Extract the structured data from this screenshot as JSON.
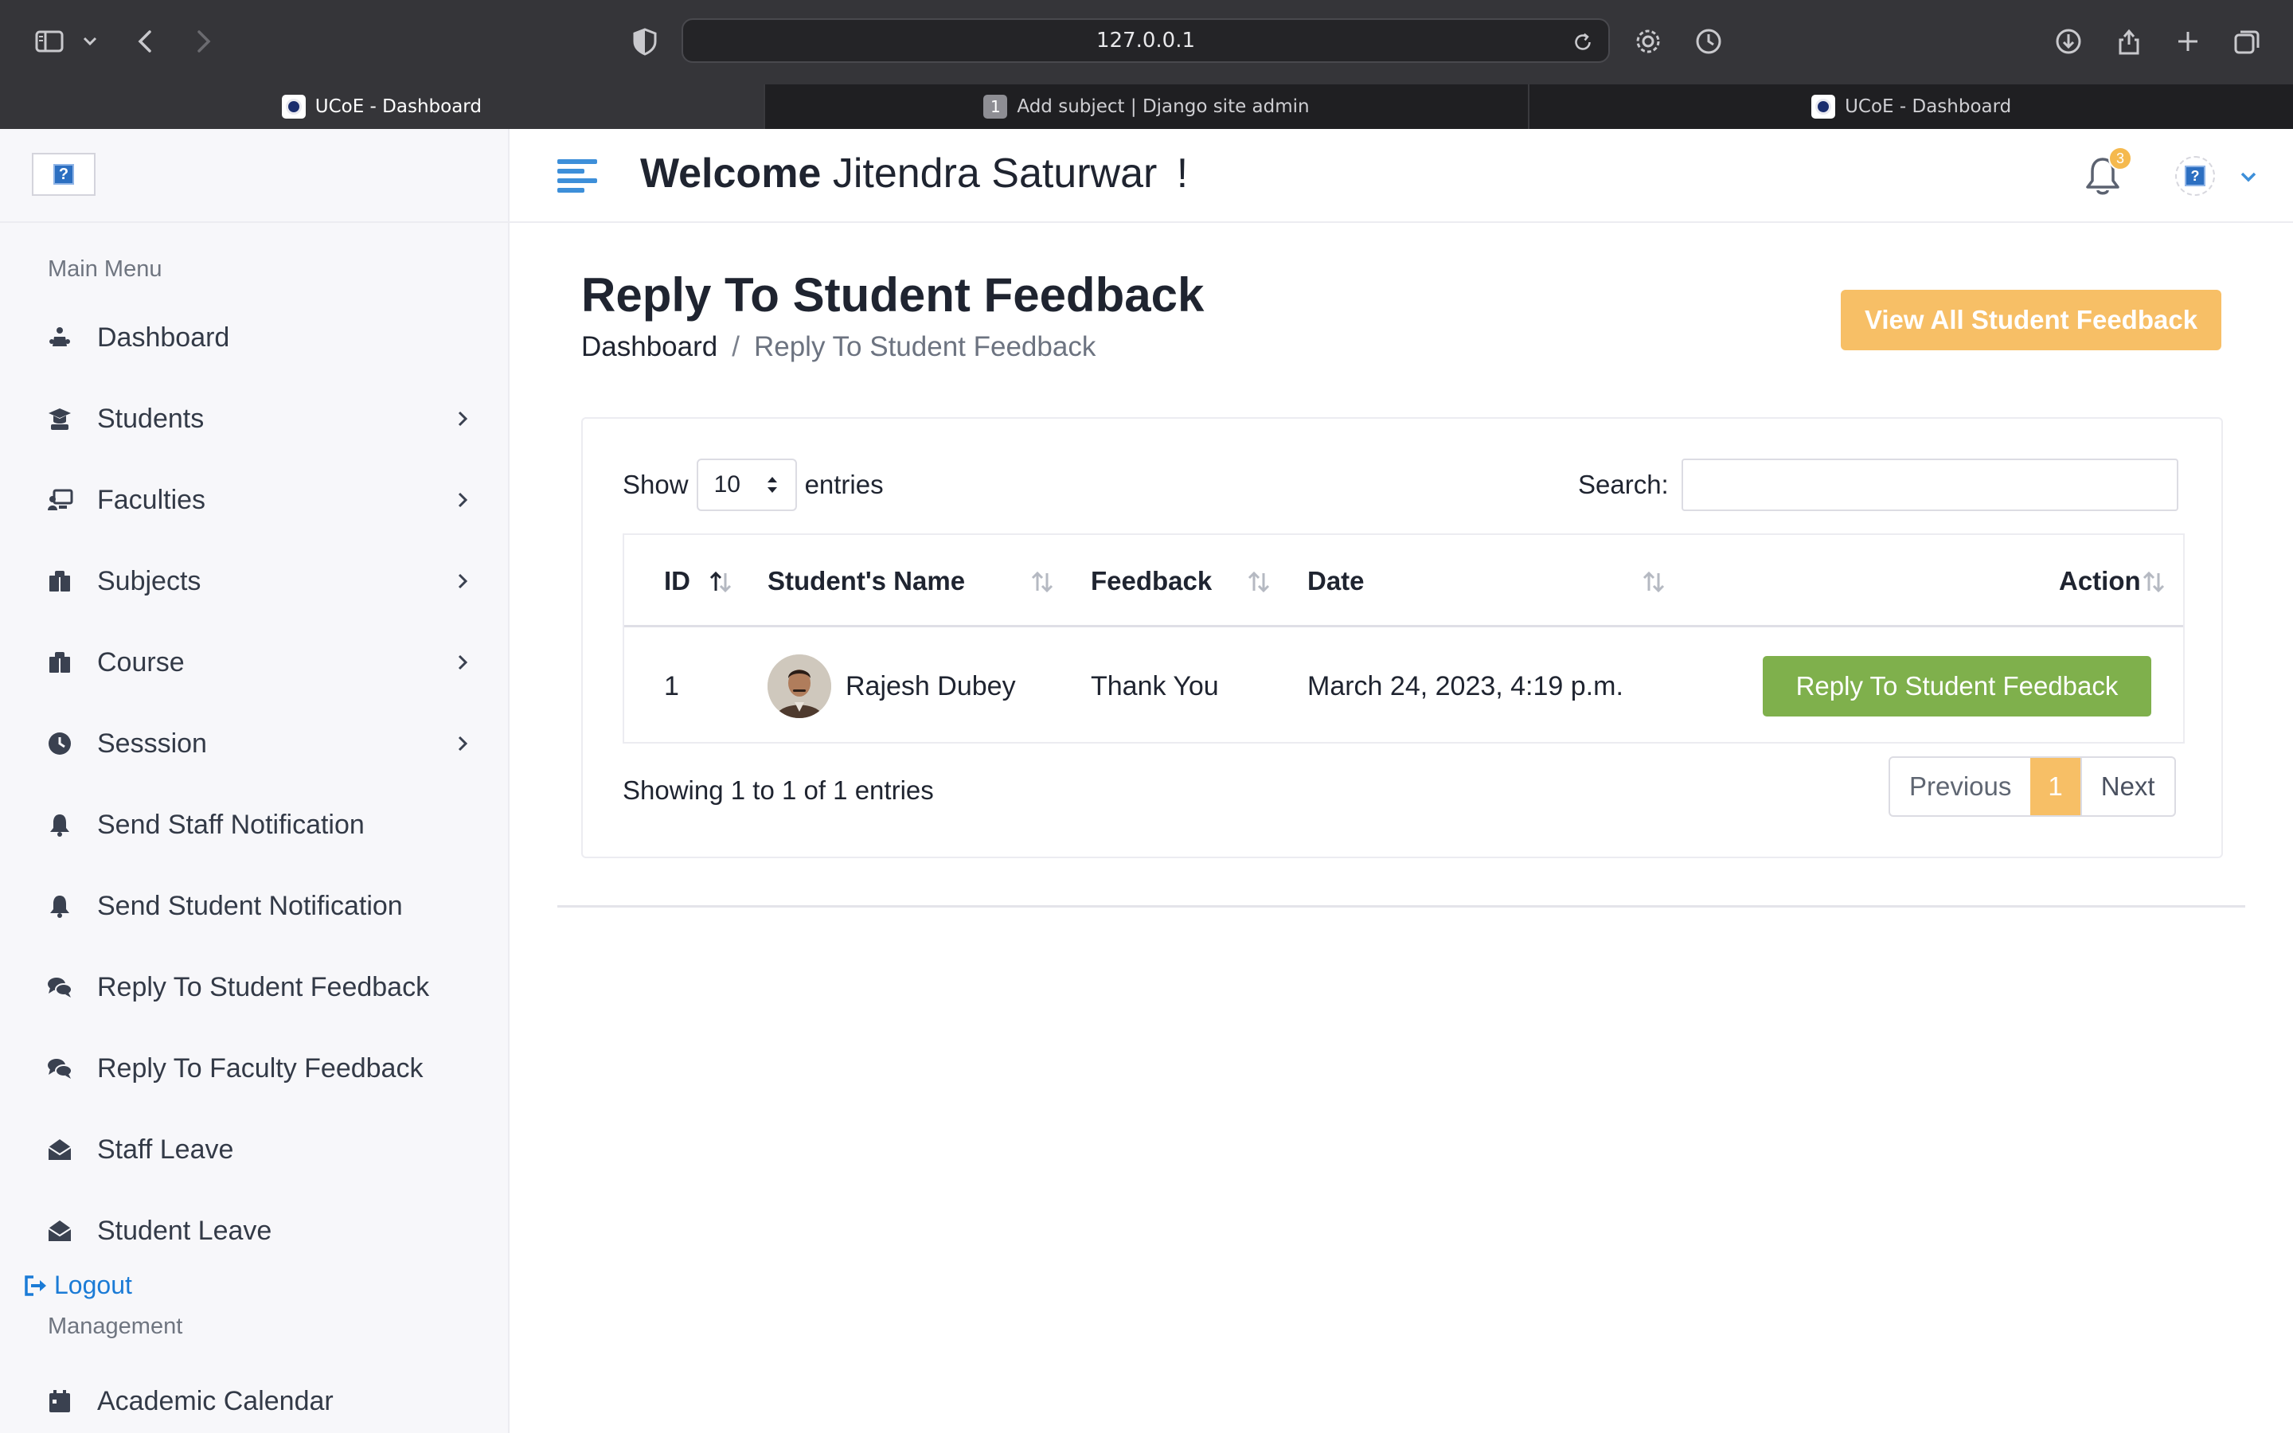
{
  "browser": {
    "url": "127.0.0.1",
    "tabs": [
      {
        "label": "UCoE - Dashboard",
        "active": true,
        "favicon": "ucoe-logo"
      },
      {
        "label": "Add subject | Django site admin",
        "active": false,
        "favicon_number": "1"
      },
      {
        "label": "UCoE - Dashboard",
        "active": false,
        "favicon": "ucoe-logo"
      }
    ]
  },
  "sidebar": {
    "logo_placeholder": "?",
    "main_menu_title": "Main Menu",
    "items": [
      {
        "label": "Dashboard",
        "icon": "dashboard-icon",
        "has_submenu": false
      },
      {
        "label": "Students",
        "icon": "student-icon",
        "has_submenu": true
      },
      {
        "label": "Faculties",
        "icon": "faculty-icon",
        "has_submenu": true
      },
      {
        "label": "Subjects",
        "icon": "book-icon",
        "has_submenu": true
      },
      {
        "label": "Course",
        "icon": "book-icon",
        "has_submenu": true
      },
      {
        "label": "Sesssion",
        "icon": "clock-icon",
        "has_submenu": true
      },
      {
        "label": "Send Staff Notification",
        "icon": "bell-icon",
        "has_submenu": false
      },
      {
        "label": "Send Student Notification",
        "icon": "bell-icon",
        "has_submenu": false
      },
      {
        "label": "Reply To Student Feedback",
        "icon": "comments-icon",
        "has_submenu": false
      },
      {
        "label": "Reply To Faculty Feedback",
        "icon": "comments-icon",
        "has_submenu": false
      },
      {
        "label": "Staff Leave",
        "icon": "envelope-open-icon",
        "has_submenu": false
      },
      {
        "label": "Student Leave",
        "icon": "envelope-open-icon",
        "has_submenu": false
      }
    ],
    "logout_label": "Logout",
    "management_title": "Management",
    "management_items": [
      {
        "label": "Academic Calendar",
        "icon": "calendar-icon"
      }
    ]
  },
  "header": {
    "welcome_strong": "Welcome",
    "user_name": "Jitendra Saturwar",
    "exclamation": "!",
    "notification_count": "3",
    "avatar_placeholder": "?"
  },
  "main": {
    "page_title": "Reply To Student Feedback",
    "breadcrumb": {
      "home": "Dashboard",
      "separator": "/",
      "current": "Reply To Student Feedback"
    },
    "view_all_button": "View All Student Feedback",
    "table_controls": {
      "show_label": "Show",
      "entries_value": "10",
      "entries_label": "entries",
      "search_label": "Search:",
      "search_value": ""
    },
    "columns": [
      "ID",
      "Student's Name",
      "Feedback",
      "Date",
      "Action"
    ],
    "rows": [
      {
        "id": "1",
        "student_name": "Rajesh Dubey",
        "feedback": "Thank You",
        "date": "March 24, 2023, 4:19 p.m.",
        "action_label": "Reply To Student Feedback"
      }
    ],
    "info": "Showing 1 to 1 of 1 entries",
    "pagination": {
      "previous": "Previous",
      "current": "1",
      "next": "Next"
    }
  },
  "colors": {
    "accent_orange": "#f7bf66",
    "reply_green": "#7fb04c",
    "link_blue": "#1b7bd6",
    "hamburger_blue": "#3d8fd9"
  }
}
